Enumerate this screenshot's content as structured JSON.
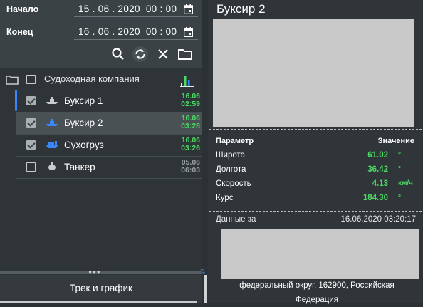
{
  "filter": {
    "start_label": "Начало",
    "start_value": "15 . 06 . 2020  00 : 00",
    "end_label": "Конец",
    "end_value": "16 . 06 . 2020  00 : 00"
  },
  "group": {
    "label": "Судоходная компания"
  },
  "ships": [
    {
      "name": "Буксир 1",
      "date": "16.06",
      "time": "02:59",
      "checked": true,
      "selected": false
    },
    {
      "name": "Буксир 2",
      "date": "16.06",
      "time": "03:28",
      "checked": true,
      "selected": true
    },
    {
      "name": "Сухогруз",
      "date": "16.06",
      "time": "03:26",
      "checked": true,
      "selected": false
    },
    {
      "name": "Танкер",
      "date": "05.06",
      "time": "06:03",
      "checked": false,
      "selected": false
    }
  ],
  "bottom_button": "Трек и график",
  "panel": {
    "title": "Буксир 2",
    "param_header": "Параметр",
    "value_header": "Значение",
    "params": [
      {
        "name": "Широта",
        "value": "61.02",
        "unit": "°"
      },
      {
        "name": "Долгота",
        "value": "36.42",
        "unit": "°"
      },
      {
        "name": "Скорость",
        "value": "4.13",
        "unit": "км/ч"
      },
      {
        "name": "Курс",
        "value": "184.30",
        "unit": "°"
      }
    ],
    "data_label": "Данные за",
    "data_value": "16.06.2020 03:20:17",
    "address_line1": "федеральный округ, 162900, Российская",
    "address_line2": "Федерация"
  },
  "colors": {
    "accent_green": "#4cd964",
    "accent_blue": "#3a86ff",
    "panel_bg": "#2f3538"
  }
}
